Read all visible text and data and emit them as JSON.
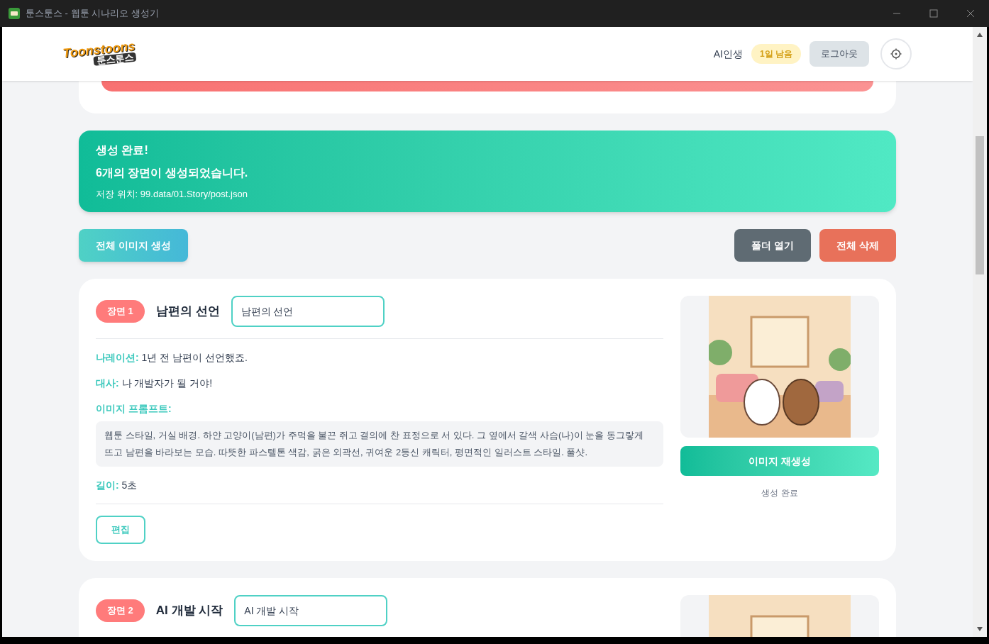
{
  "window": {
    "title": "툰스툰스 - 웹툰 시나리오 생성기"
  },
  "header": {
    "logo": {
      "latin": "Toonstoons",
      "korean": "툰스툰스"
    },
    "user": "AI인생",
    "badge": "1일 남음",
    "logout": "로그아웃"
  },
  "success": {
    "title": "생성 완료!",
    "message": "6개의 장면이 생성되었습니다.",
    "path": "저장 위치: 99.data/01.Story/post.json"
  },
  "actions": {
    "generate_all": "전체 이미지 생성",
    "open_folder": "폴더 열기",
    "delete_all": "전체 삭제"
  },
  "scenes": [
    {
      "badge": "장면 1",
      "title": "남편의 선언",
      "title_value": "남편의 선언",
      "fields": [
        {
          "kind": "line",
          "label": "나레이션:",
          "value": "1년 전 남편이 선언했죠."
        },
        {
          "kind": "line",
          "label": "대사:",
          "value": "나 개발자가 될 거야!"
        },
        {
          "kind": "block",
          "label": "이미지 프롬프트:",
          "value": "웹툰 스타일, 거실 배경. 하얀 고양이(남편)가 주먹을 불끈 쥐고 결의에 찬 표정으로 서 있다. 그 옆에서 갈색 사슴(나)이 눈을 동그랗게 뜨고 남편을 바라보는 모습. 따뜻한 파스텔톤 색감, 굵은 외곽선, 귀여운 2등신 캐릭터, 평면적인 일러스트 스타일. 풀샷."
        },
        {
          "kind": "line",
          "label": "길이:",
          "value": "5초"
        }
      ],
      "edit": "편집",
      "regenerate": "이미지 재생성",
      "status": "생성 완료"
    },
    {
      "badge": "장면 2",
      "title": "AI 개발 시작",
      "title_value": "AI 개발 시작"
    }
  ]
}
